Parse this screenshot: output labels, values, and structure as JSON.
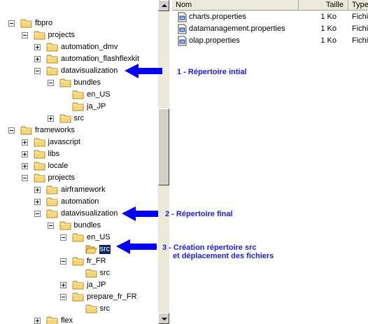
{
  "tree": [
    {
      "label": "fbpro",
      "depth": 0,
      "toggle": "minus",
      "selected": false
    },
    {
      "label": "projects",
      "depth": 1,
      "toggle": "minus",
      "selected": false
    },
    {
      "label": "automation_dmv",
      "depth": 2,
      "toggle": "plus",
      "selected": false
    },
    {
      "label": "automation_flashflexkit",
      "depth": 2,
      "toggle": "plus",
      "selected": false
    },
    {
      "label": "datavisualization",
      "depth": 2,
      "toggle": "minus",
      "selected": false
    },
    {
      "label": "bundles",
      "depth": 3,
      "toggle": "minus",
      "selected": false
    },
    {
      "label": "en_US",
      "depth": 4,
      "toggle": "none",
      "selected": false
    },
    {
      "label": "ja_JP",
      "depth": 4,
      "toggle": "none",
      "selected": false
    },
    {
      "label": "src",
      "depth": 3,
      "toggle": "plus",
      "selected": false
    },
    {
      "label": "frameworks",
      "depth": 0,
      "toggle": "minus",
      "selected": false
    },
    {
      "label": "javascript",
      "depth": 1,
      "toggle": "plus",
      "selected": false
    },
    {
      "label": "libs",
      "depth": 1,
      "toggle": "plus",
      "selected": false
    },
    {
      "label": "locale",
      "depth": 1,
      "toggle": "plus",
      "selected": false
    },
    {
      "label": "projects",
      "depth": 1,
      "toggle": "minus",
      "selected": false
    },
    {
      "label": "airframework",
      "depth": 2,
      "toggle": "plus",
      "selected": false
    },
    {
      "label": "automation",
      "depth": 2,
      "toggle": "plus",
      "selected": false
    },
    {
      "label": "datavisualization",
      "depth": 2,
      "toggle": "minus",
      "selected": false
    },
    {
      "label": "bundles",
      "depth": 3,
      "toggle": "minus",
      "selected": false
    },
    {
      "label": "en_US",
      "depth": 4,
      "toggle": "minus",
      "selected": false
    },
    {
      "label": "src",
      "depth": 5,
      "toggle": "none",
      "selected": true
    },
    {
      "label": "fr_FR",
      "depth": 4,
      "toggle": "minus",
      "selected": false
    },
    {
      "label": "src",
      "depth": 5,
      "toggle": "none",
      "selected": false
    },
    {
      "label": "ja_JP",
      "depth": 4,
      "toggle": "plus",
      "selected": false
    },
    {
      "label": "prepare_fr_FR",
      "depth": 4,
      "toggle": "minus",
      "selected": false
    },
    {
      "label": "src",
      "depth": 5,
      "toggle": "none",
      "selected": false
    },
    {
      "label": "flex",
      "depth": 2,
      "toggle": "plus",
      "selected": false
    }
  ],
  "list": {
    "columns": {
      "name": "Nom",
      "size": "Taille",
      "type": "Type"
    },
    "files": [
      {
        "name": "charts.properties",
        "size": "1 Ko",
        "type": "Fichie"
      },
      {
        "name": "datamanagement.properties",
        "size": "1 Ko",
        "type": "Fichie"
      },
      {
        "name": "olap.properties",
        "size": "1 Ko",
        "type": "Fichie"
      }
    ]
  },
  "annotations": [
    {
      "text": "1 - Répertoire intial"
    },
    {
      "text": "2 - Répertoire final"
    },
    {
      "text": "3 - Création répertoire src"
    },
    {
      "text": "et déplacement des fichiers"
    }
  ],
  "colors": {
    "arrow": "#0000ff",
    "annotation_text": "#1a1aff",
    "folder": "#f7d775",
    "selection": "#0a246a"
  }
}
